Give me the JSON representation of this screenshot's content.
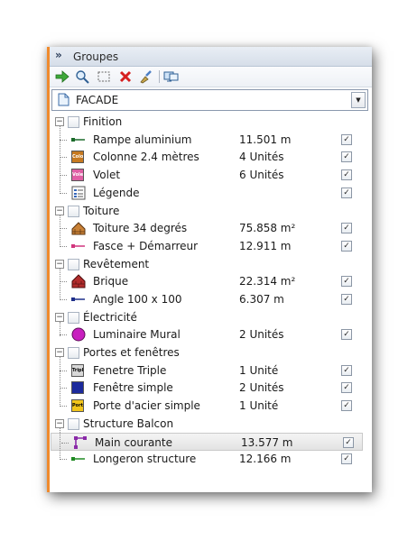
{
  "panel": {
    "title": "Groupes",
    "accent_color": "#f08a2c",
    "toolbar": {
      "icons": [
        "arrow-right-icon",
        "search-icon",
        "select-box-icon",
        "delete-icon",
        "brush-icon",
        "screen-icon"
      ]
    },
    "selector": {
      "value": "FACADE"
    }
  },
  "tree": {
    "groups": [
      {
        "label": "Finition",
        "items": [
          {
            "label": "Rampe aluminium",
            "value": "11.501 m",
            "icon_text": ""
          },
          {
            "label": "Colonne 2.4 mètres",
            "value": "4 Unités",
            "icon_text": "Colo"
          },
          {
            "label": "Volet",
            "value": "6 Unités",
            "icon_text": "Volet"
          },
          {
            "label": "Légende",
            "value": "",
            "icon_text": ""
          }
        ]
      },
      {
        "label": "Toiture",
        "items": [
          {
            "label": "Toiture 34 degrés",
            "value": "75.858 m²",
            "icon_text": ""
          },
          {
            "label": "Fasce + Démarreur",
            "value": "12.911 m",
            "icon_text": ""
          }
        ]
      },
      {
        "label": "Revêtement",
        "items": [
          {
            "label": "Brique",
            "value": "22.314 m²",
            "icon_text": ""
          },
          {
            "label": "Angle 100 x 100",
            "value": "6.307 m",
            "icon_text": ""
          }
        ]
      },
      {
        "label": "Électricité",
        "items": [
          {
            "label": "Luminaire Mural",
            "value": "2 Unités",
            "icon_text": "Lum"
          }
        ]
      },
      {
        "label": "Portes et fenêtres",
        "items": [
          {
            "label": "Fenetre Triple",
            "value": "1 Unité",
            "icon_text": "Triple"
          },
          {
            "label": "Fenêtre simple",
            "value": "2 Unités",
            "icon_text": ""
          },
          {
            "label": "Porte d'acier simple",
            "value": "1 Unité",
            "icon_text": "Porte"
          }
        ]
      },
      {
        "label": "Structure Balcon",
        "items": [
          {
            "label": "Main courante",
            "value": "13.577 m",
            "icon_text": ""
          },
          {
            "label": "Longeron structure",
            "value": "12.166 m",
            "icon_text": ""
          }
        ]
      }
    ]
  }
}
